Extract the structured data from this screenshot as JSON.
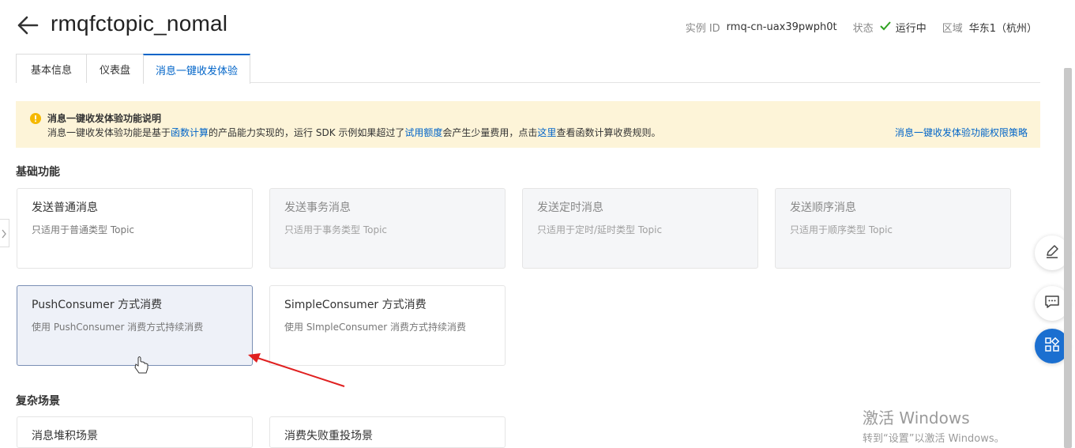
{
  "header": {
    "title": "rmqfctopic_nomal",
    "instance_label": "实例 ID",
    "instance_value": "rmq-cn-uax39pwph0t",
    "status_label": "状态",
    "status_value": "运行中",
    "region_label": "区域",
    "region_value": "华东1（杭州）"
  },
  "tabs": [
    {
      "label": "基本信息"
    },
    {
      "label": "仪表盘"
    },
    {
      "label": "消息一键收发体验"
    }
  ],
  "notice": {
    "title": "消息一键收发体验功能说明",
    "text_part1": "消息一键收发体验功能是基于",
    "link1": "函数计算",
    "text_part2": "的产品能力实现的，运行 SDK 示例如果超过了",
    "link2": "试用额度",
    "text_part3": "会产生少量费用，点击",
    "link3": "这里",
    "text_part4": "查看函数计算收费规则。",
    "policy_link": "消息一键收发体验功能权限策略"
  },
  "basic_section": {
    "title": "基础功能",
    "cards": [
      {
        "title": "发送普通消息",
        "desc": "只适用于普通类型 Topic"
      },
      {
        "title": "发送事务消息",
        "desc": "只适用于事务类型 Topic"
      },
      {
        "title": "发送定时消息",
        "desc": "只适用于定时/延时类型 Topic"
      },
      {
        "title": "发送顺序消息",
        "desc": "只适用于顺序类型 Topic"
      },
      {
        "title": "PushConsumer 方式消费",
        "desc": "使用 PushConsumer 消费方式持续消费"
      },
      {
        "title": "SimpleConsumer 方式消费",
        "desc": "使用 SImpleConsumer 消费方式持续消费"
      }
    ]
  },
  "complex_section": {
    "title": "复杂场景",
    "cards": [
      {
        "title": "消息堆积场景"
      },
      {
        "title": "消费失败重投场景"
      }
    ]
  },
  "watermark": {
    "line1": "激活 Windows",
    "line2": "转到“设置”以激活 Windows。"
  },
  "colors": {
    "accent": "#0064c8",
    "notice_bg": "#fdf4d8",
    "success": "#2ea121",
    "arrow": "#e02020"
  }
}
